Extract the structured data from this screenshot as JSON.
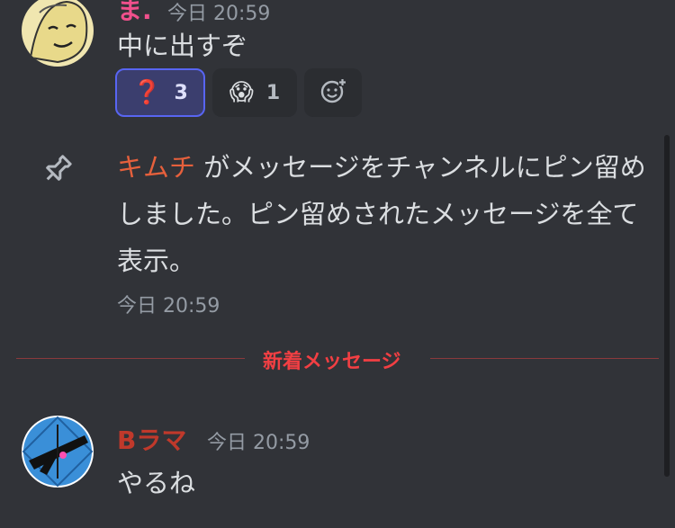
{
  "messages": [
    {
      "username": "ま.",
      "timestamp": "今日 20:59",
      "content": "中に出すぞ",
      "username_color": "#f0508c",
      "reactions": [
        {
          "emoji": "❓",
          "count": "3",
          "active": true
        },
        {
          "emoji": "😱",
          "count": "1",
          "active": false
        }
      ],
      "add_reaction_icon": "add-reaction-icon"
    },
    {
      "username": "Bラマ",
      "timestamp": "今日 20:59",
      "content": "やるね",
      "username_color": "#c0392b"
    }
  ],
  "system_message": {
    "user": "キムチ",
    "action_text": " がメッセージをチャンネルにピン留めしました。",
    "link_text": "ピン留めされたメッセージを全て表示。",
    "timestamp": "今日 20:59",
    "icon": "pin-icon"
  },
  "divider": {
    "label": "新着メッセージ"
  },
  "colors": {
    "background": "#313338",
    "new_divider": "#f23f43",
    "system_user": "#e6603c",
    "reaction_active_border": "#5865f2"
  }
}
